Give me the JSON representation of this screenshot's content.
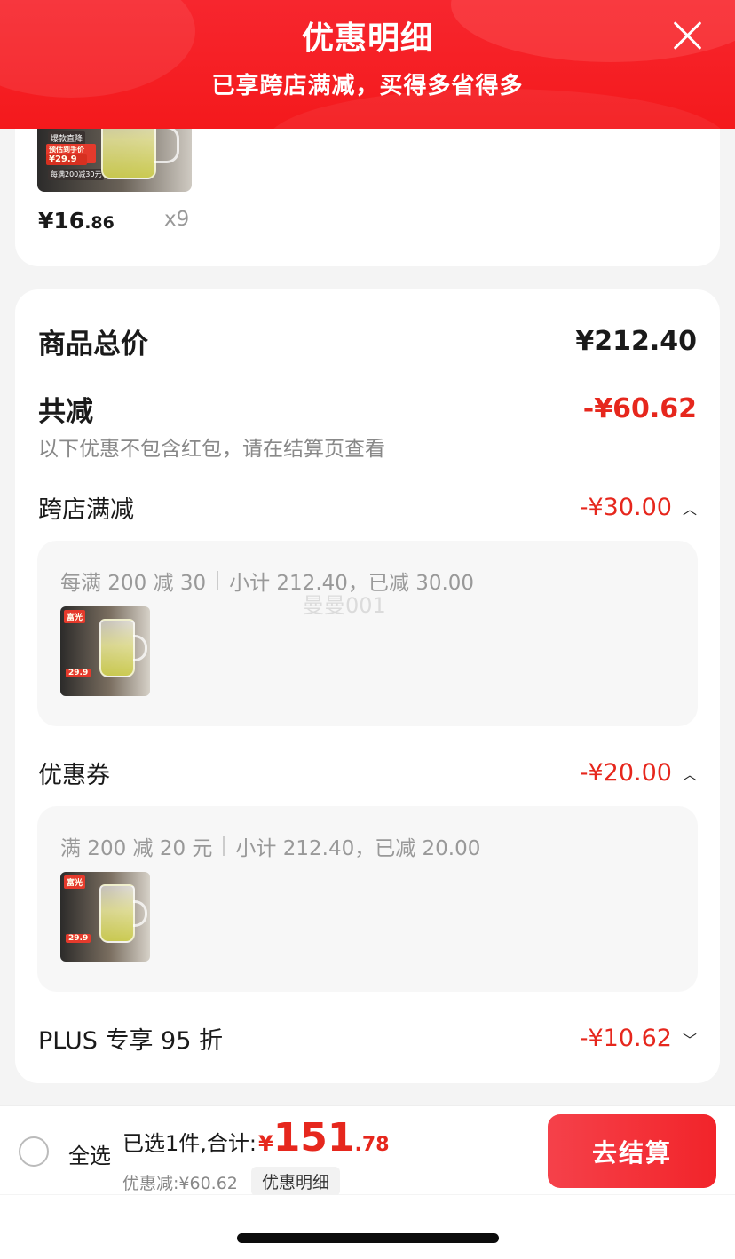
{
  "header": {
    "title": "优惠明细",
    "subtitle": "已享跨店满减，买得多省得多"
  },
  "top_item": {
    "price_main": "¥16",
    "price_decimal": ".86",
    "quantity": "x9",
    "thumb_tags": [
      "爆款直降",
      "预估到手价",
      "¥",
      "29.9",
      "每满200减30元"
    ]
  },
  "summary": {
    "total_label": "商品总价",
    "total_value": "¥212.40",
    "reduced_label": "共减",
    "reduced_value": "-¥60.62",
    "note": "以下优惠不包含红包，请在结算页查看"
  },
  "promos": [
    {
      "label": "跨店满减",
      "value": "-¥30.00",
      "expanded": true,
      "rule": "每满 200 减 30",
      "detail": "小计 212.40，已减 30.00"
    },
    {
      "label": "优惠券",
      "value": "-¥20.00",
      "expanded": true,
      "rule": "满 200 减 20 元",
      "detail": "小计 212.40，已减 20.00"
    },
    {
      "label": "PLUS 专享 95 折",
      "value": "-¥10.62",
      "expanded": false
    }
  ],
  "mini_thumb_tags": [
    "富光",
    "29.9"
  ],
  "watermark": "曼曼001",
  "bottom_bar": {
    "select_all": "全选",
    "selected_text": "已选1件,合计:",
    "currency": "¥",
    "total_main": "151",
    "total_decimal": ".78",
    "discount_text": "优惠减:¥60.62",
    "detail_tag": "优惠明细",
    "checkout": "去结算"
  },
  "colors": {
    "header_red": "#f4191c",
    "price_red": "#e6271d",
    "background": "#f4f4f4"
  },
  "icons": {
    "close": "close-icon",
    "expand_up": "chevron-up-icon",
    "expand_down": "chevron-down-icon",
    "radio": "radio-unchecked-icon"
  }
}
